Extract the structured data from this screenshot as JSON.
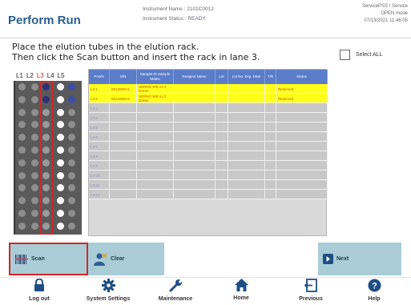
{
  "header": {
    "title": "Perform Run",
    "instrument_name": "Instrument Name : 2101C0012",
    "instrument_status": "Instrument Status : READY",
    "service_line1": "ServicePSS / Service",
    "service_line2": "OPEN mode",
    "datetime": "07/13/2021 11:46:05"
  },
  "instructions": {
    "line1": "Place the elution tubes in the elution rack.",
    "line2": "Then click the Scan button and insert the rack in lane 3."
  },
  "select_all_label": "Select ALL",
  "lanes": [
    "L1",
    "L2",
    "L3",
    "L4",
    "L5"
  ],
  "table": {
    "columns": [
      "Pos/N",
      "S/N",
      "Sample ID Sample Matrix",
      "Reagent Name",
      "Lot",
      "Lot No. Exp. Date",
      "T/R",
      "Status"
    ],
    "rows": [
      {
        "pos": "L3-1",
        "sn": "0012000A1",
        "sample": "SERNO WB v1.2 Green",
        "reagent": "",
        "lot": "",
        "exp": "",
        "tr": "",
        "status": "Reserved",
        "state": "yellow"
      },
      {
        "pos": "L3-2",
        "sn": "0012000A2",
        "sample": "SERNO WB v1.2 Green",
        "reagent": "",
        "lot": "",
        "exp": "",
        "tr": "",
        "status": "Reserved",
        "state": "yellow"
      },
      {
        "pos": "L3-3",
        "sn": "",
        "sample": "",
        "reagent": "",
        "lot": "",
        "exp": "",
        "tr": "",
        "status": "",
        "state": "gray"
      },
      {
        "pos": "L3-4",
        "sn": "",
        "sample": "",
        "reagent": "",
        "lot": "",
        "exp": "",
        "tr": "",
        "status": "",
        "state": "gray"
      },
      {
        "pos": "L3-5",
        "sn": "",
        "sample": "",
        "reagent": "",
        "lot": "",
        "exp": "",
        "tr": "",
        "status": "",
        "state": "gray"
      },
      {
        "pos": "L3-6",
        "sn": "",
        "sample": "",
        "reagent": "",
        "lot": "",
        "exp": "",
        "tr": "",
        "status": "",
        "state": "gray"
      },
      {
        "pos": "L3-7",
        "sn": "",
        "sample": "",
        "reagent": "",
        "lot": "",
        "exp": "",
        "tr": "",
        "status": "",
        "state": "gray"
      },
      {
        "pos": "L3-8",
        "sn": "",
        "sample": "",
        "reagent": "",
        "lot": "",
        "exp": "",
        "tr": "",
        "status": "",
        "state": "gray"
      },
      {
        "pos": "L3-9",
        "sn": "",
        "sample": "",
        "reagent": "",
        "lot": "",
        "exp": "",
        "tr": "",
        "status": "",
        "state": "gray"
      },
      {
        "pos": "L3-10",
        "sn": "",
        "sample": "",
        "reagent": "",
        "lot": "",
        "exp": "",
        "tr": "",
        "status": "",
        "state": "gray"
      },
      {
        "pos": "L3-11",
        "sn": "",
        "sample": "",
        "reagent": "",
        "lot": "",
        "exp": "",
        "tr": "",
        "status": "",
        "state": "gray"
      },
      {
        "pos": "L3-12",
        "sn": "",
        "sample": "",
        "reagent": "",
        "lot": "",
        "exp": "",
        "tr": "",
        "status": "",
        "state": "gray"
      }
    ]
  },
  "buttons": {
    "scan": "Scan",
    "clear": "Clear",
    "next": "Next"
  },
  "footer": {
    "logout": "Log out",
    "system_settings": "System Settings",
    "maintenance": "Maintenance",
    "home": "Home",
    "previous": "Previous",
    "help": "Help"
  },
  "colors": {
    "title": "#2a5d8f",
    "button": "#a9ccd7",
    "table_header": "#5b7cc8",
    "reserved_row": "#ffff1a",
    "highlight": "#d32626"
  },
  "icons": {
    "scan": "barcode-scan-icon",
    "clear": "clear-user-icon",
    "next": "chevron-right-icon",
    "logout": "lock-icon",
    "system_settings": "gear-icon",
    "maintenance": "wrench-icon",
    "home": "home-icon",
    "previous": "previous-door-icon",
    "help": "help-icon"
  }
}
